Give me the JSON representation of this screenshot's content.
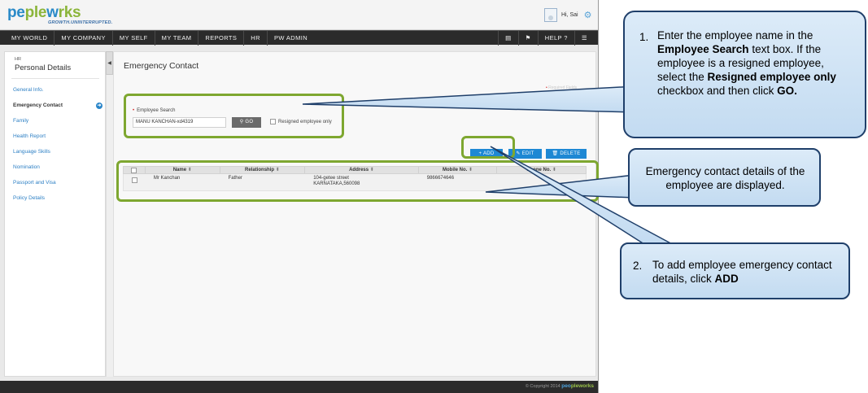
{
  "app": {
    "logo_part1": "pe",
    "logo_part2": "ple",
    "logo_part3": "w",
    "logo_part4": "rks",
    "logo_tagline": "GROWTH.UNINTERRUPTED.",
    "greeting": "Hi, Sai"
  },
  "nav": {
    "items": [
      "MY WORLD",
      "MY COMPANY",
      "MY SELF",
      "MY TEAM",
      "REPORTS",
      "HR",
      "PW ADMIN"
    ],
    "help": "HELP"
  },
  "sidebar": {
    "section": "HR",
    "title": "Personal Details",
    "items": [
      "General Info.",
      "Emergency Contact",
      "Family",
      "Health Report",
      "Language Skills",
      "Nomination",
      "Passport and Visa",
      "Policy Details"
    ],
    "active_index": 1
  },
  "content": {
    "page_title": "Emergency Contact",
    "required_note": "Required Fields",
    "search_label": "Employee Search",
    "search_value": "MANU KANCHAN-xd4319",
    "go_label": "GO",
    "resigned_label": "Resigned employee only",
    "add_label": "ADD",
    "edit_label": "EDIT",
    "delete_label": "DELETE"
  },
  "table": {
    "columns": [
      "Name",
      "Relationship",
      "Address",
      "Mobile No.",
      "Phone No."
    ],
    "rows": [
      {
        "name": "Mr Kanchan",
        "relationship": "Father",
        "address_line1": "104-getee street",
        "address_line2": "KARNATAKA,560098",
        "mobile": "9866674646",
        "phone": ""
      }
    ]
  },
  "footer": {
    "copyright": "© Copyright 2014",
    "brand1": "peo",
    "brand2": "pleworks"
  },
  "callouts": {
    "c1_num": "1.",
    "c1_a": "Enter the employee name in the ",
    "c1_b": "Employee Search",
    "c1_c": "  text box. If the employee is a resigned employee, select  the ",
    "c1_d": "Resigned employee only",
    "c1_e": " checkbox and then click ",
    "c1_f": "GO.",
    "c2_text": "Emergency contact details of the employee are displayed.",
    "c3_num": "2.",
    "c3_a": "To add employee emergency contact details, click ",
    "c3_b": "ADD"
  },
  "colors": {
    "accent_blue": "#1e88d4",
    "highlight_green": "#7ea730",
    "callout_border": "#1f3f6a",
    "nav_dark": "#2b2b2b"
  }
}
